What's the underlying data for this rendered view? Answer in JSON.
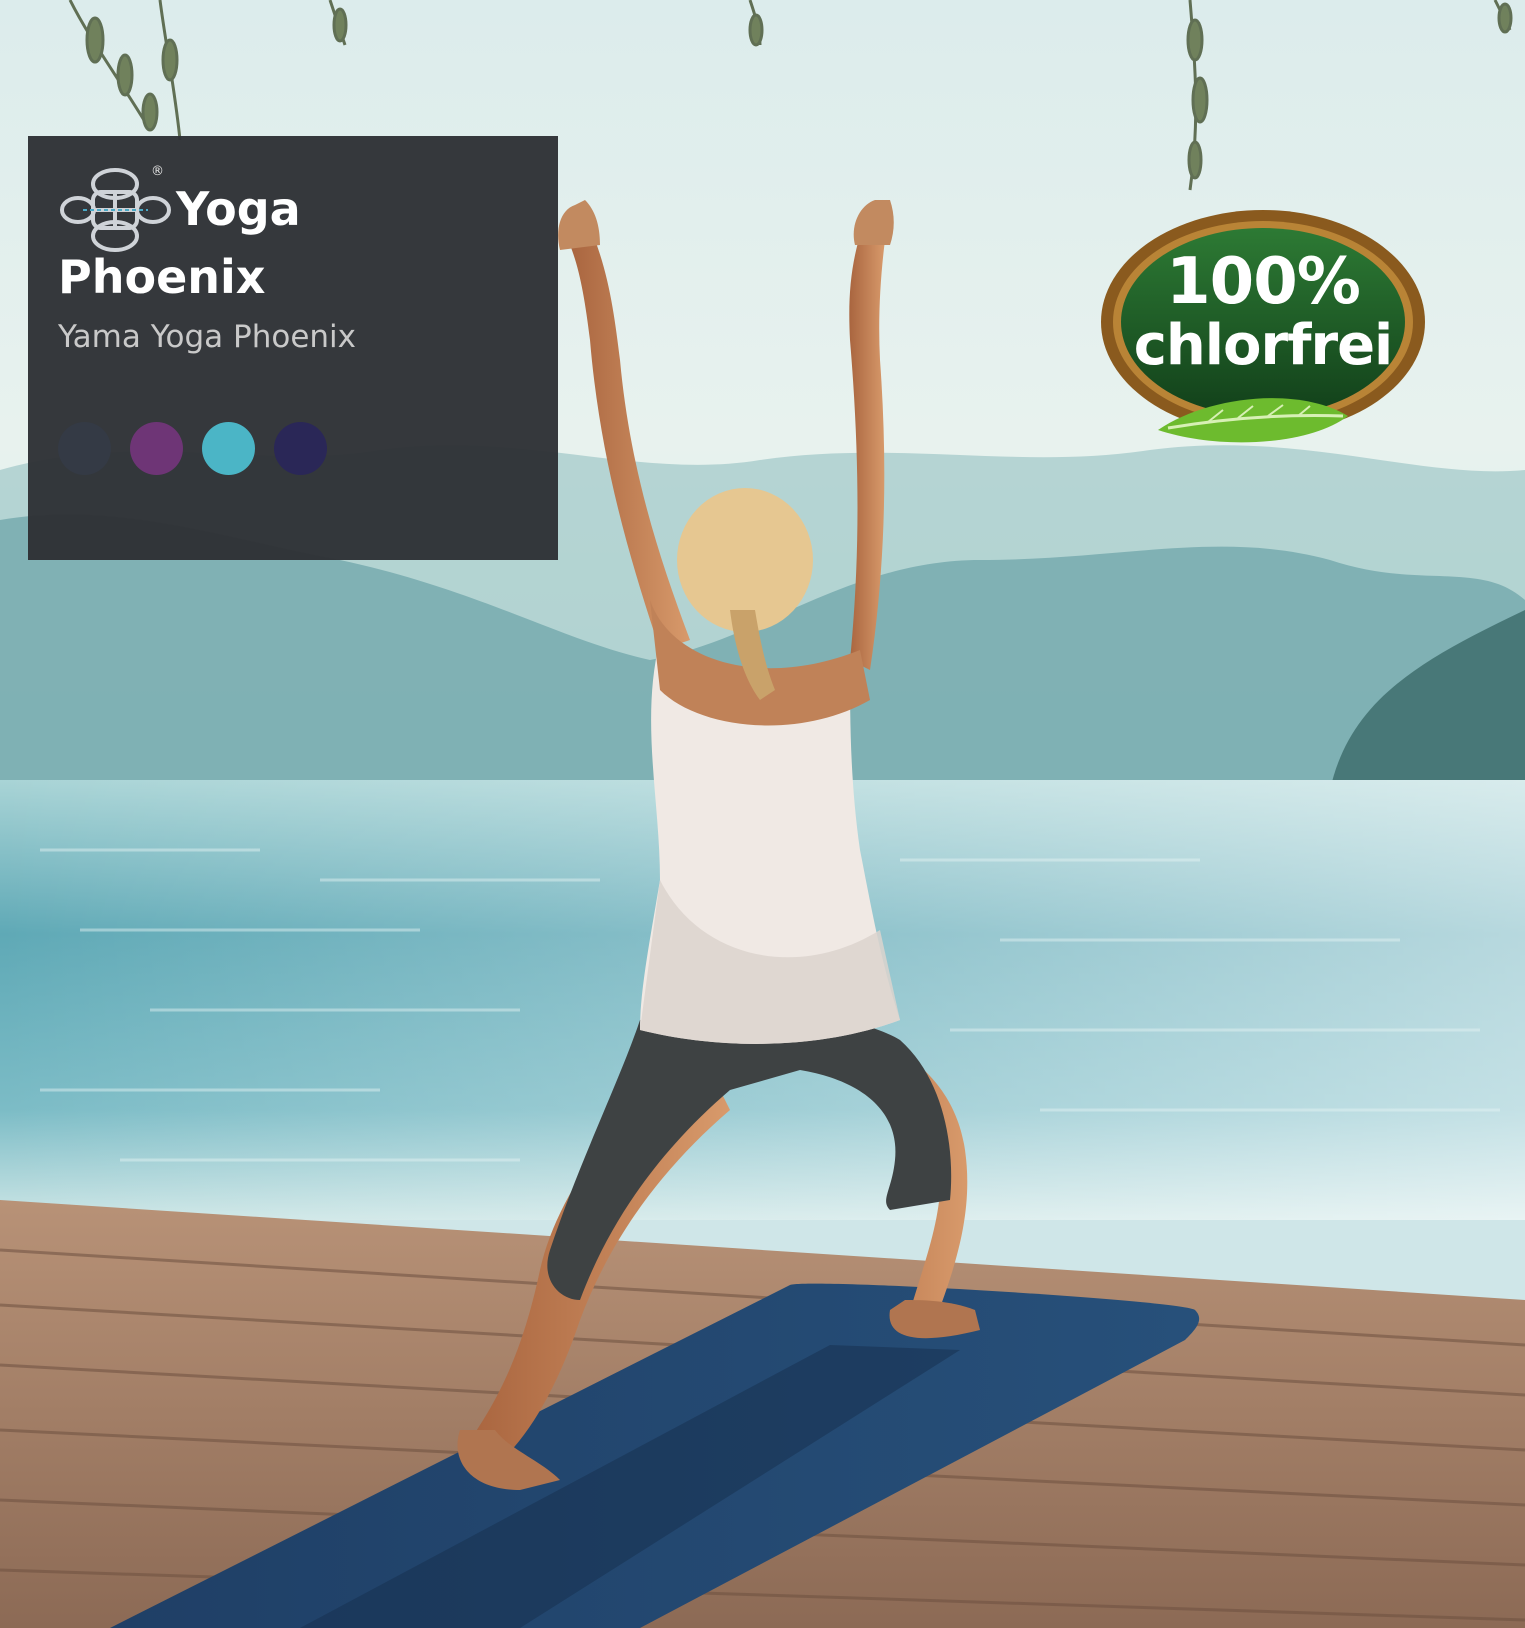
{
  "card": {
    "brand_line_1": "Yoga",
    "brand_line_2": "Phoenix",
    "registered_mark": "®",
    "product_name": "Yama Yoga Phoenix",
    "logo_icon": "endless-knot-icon",
    "background_color": "#2f3135",
    "color_swatches": [
      "#343a45",
      "#6e3576",
      "#4bb5c6",
      "#2a2757"
    ]
  },
  "badge": {
    "line_1": "100%",
    "line_2": "chlorfrei",
    "fill_color": "#1f5a23",
    "rim_color": "#8a5a1e",
    "leaf_icon": "leaf-icon"
  },
  "photo": {
    "scene_elements": [
      "yoga-practitioner",
      "yoga-mat",
      "wooden-dock",
      "lake",
      "mountains",
      "willow-branches"
    ]
  }
}
